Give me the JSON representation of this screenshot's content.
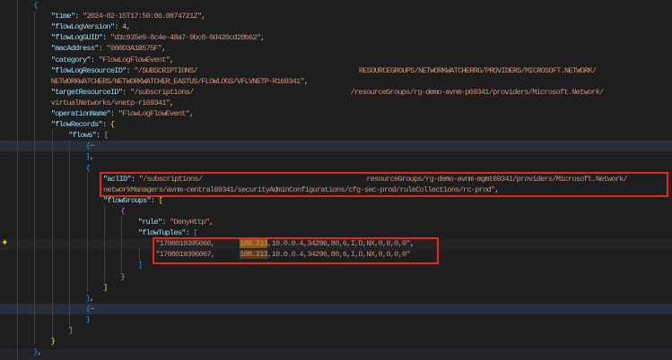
{
  "colors": {
    "key": "#9cdcfe",
    "string": "#ce9178",
    "number": "#b5cea8",
    "bracket_gold": "#ffd700",
    "bracket_purple": "#da70d6",
    "bracket_blue": "#179fff",
    "highlight_box": "#e0291c"
  },
  "icons": {
    "gutter": "sparkle-icon",
    "fold": "fold-ellipsis-icon"
  },
  "lines": [
    {
      "lv": 1,
      "t": [
        [
          "b3",
          "{"
        ]
      ]
    },
    {
      "lv": 2,
      "t": [
        [
          "k",
          "\"time\""
        ],
        [
          "p",
          ": "
        ],
        [
          "s",
          "\"2024-02-15T17:50:06.0874721Z\""
        ],
        [
          "p",
          ","
        ]
      ]
    },
    {
      "lv": 2,
      "t": [
        [
          "k",
          "\"flowLogVersion\""
        ],
        [
          "p",
          ": "
        ],
        [
          "n",
          "4"
        ],
        [
          "p",
          ","
        ]
      ]
    },
    {
      "lv": 2,
      "t": [
        [
          "k",
          "\"flowLogGUID\""
        ],
        [
          "p",
          ": "
        ],
        [
          "s",
          "\"d3c935e9-8c4e-48a7-9bc0-0d420cd20b62\""
        ],
        [
          "p",
          ","
        ]
      ]
    },
    {
      "lv": 2,
      "t": [
        [
          "k",
          "\"macAddress\""
        ],
        [
          "p",
          ": "
        ],
        [
          "s",
          "\"000D3A1B575F\""
        ],
        [
          "p",
          ","
        ]
      ]
    },
    {
      "lv": 2,
      "t": [
        [
          "k",
          "\"category\""
        ],
        [
          "p",
          ": "
        ],
        [
          "s",
          "\"FlowLogFlowEvent\""
        ],
        [
          "p",
          ","
        ]
      ]
    },
    {
      "lv": 2,
      "t": [
        [
          "k",
          "\"flowLogResourceID\""
        ],
        [
          "p",
          ": "
        ],
        [
          "s",
          "\"/SUBSCRIPTIONS/"
        ],
        [
          "gap",
          ""
        ],
        [
          "s",
          "RESOURCEGROUPS/NETWORKWATCHERRG/PROVIDERS/MICROSOFT.NETWORK/"
        ]
      ]
    },
    {
      "lv": 2,
      "t": [
        [
          "s",
          "NETWORKWATCHERS/NETWORKWATCHER_EASTUS/FLOWLOGS/VFLVNETP-R169341\""
        ],
        [
          "p",
          ","
        ]
      ]
    },
    {
      "lv": 2,
      "t": [
        [
          "k",
          "\"targetResourceID\""
        ],
        [
          "p",
          ": "
        ],
        [
          "s",
          "\"/subscriptions/"
        ],
        [
          "gap",
          ""
        ],
        [
          "s",
          "/resourceGroups/rg-demo-avnm-p69341/providers/Microsoft.Network/"
        ]
      ]
    },
    {
      "lv": 2,
      "t": [
        [
          "s",
          "virtualNetworks/vnetp-r169341\""
        ],
        [
          "p",
          ","
        ]
      ]
    },
    {
      "lv": 2,
      "t": [
        [
          "k",
          "\"operationName\""
        ],
        [
          "p",
          ": "
        ],
        [
          "s",
          "\"FlowLogFlowEvent\""
        ],
        [
          "p",
          ","
        ]
      ]
    },
    {
      "lv": 2,
      "t": [
        [
          "k",
          "\"flowRecords\""
        ],
        [
          "p",
          ": "
        ],
        [
          "b1",
          "{"
        ]
      ]
    },
    {
      "lv": 3,
      "t": [
        [
          "k",
          "\"flows\""
        ],
        [
          "p",
          ": "
        ],
        [
          "b2",
          "["
        ]
      ]
    },
    {
      "lv": 4,
      "t": [
        [
          "b3",
          "{"
        ],
        [
          "f",
          "⋯"
        ]
      ]
    },
    {
      "lv": 4,
      "t": [
        [
          "b3",
          "}"
        ],
        [
          "p",
          ","
        ]
      ]
    },
    {
      "lv": 4,
      "t": [
        [
          "b3",
          "{"
        ]
      ]
    },
    {
      "lv": 5,
      "t": [
        [
          "k",
          "\"aclID\""
        ],
        [
          "p",
          ": "
        ],
        [
          "s",
          "\"/subscriptions/"
        ],
        [
          "gap",
          ""
        ],
        [
          "s",
          "resourceGroups/rg-demo-avnm-mgmt69341/providers/Microsoft.Network/"
        ]
      ]
    },
    {
      "lv": 5,
      "t": [
        [
          "s",
          "networkManagers/avnm-central69341/securityAdminConfigurations/cfg-sec-prod/ruleCollections/rc-prod\""
        ],
        [
          "p",
          ","
        ]
      ]
    },
    {
      "lv": 5,
      "t": [
        [
          "k",
          "\"flowGroups\""
        ],
        [
          "p",
          ": "
        ],
        [
          "b1",
          "["
        ]
      ]
    },
    {
      "lv": 6,
      "t": [
        [
          "b2",
          "{"
        ]
      ]
    },
    {
      "lv": 7,
      "t": [
        [
          "k",
          "\"rule\""
        ],
        [
          "p",
          ": "
        ],
        [
          "s",
          "\"DenyHttp\""
        ],
        [
          "p",
          ","
        ]
      ]
    },
    {
      "lv": 7,
      "t": [
        [
          "k",
          "\"flowTuples\""
        ],
        [
          "p",
          ": "
        ],
        [
          "b3",
          "["
        ]
      ]
    },
    {
      "lv": 8,
      "t": [
        [
          "s",
          "\"1708019395066,"
        ],
        [
          "gap",
          ""
        ],
        [
          "ip",
          "108.213"
        ],
        [
          "s",
          ",10.0.0.4,34296,80,6,I,D,NX,0,0,0,0\""
        ],
        [
          "p",
          ","
        ]
      ]
    },
    {
      "lv": 8,
      "t": [
        [
          "s",
          "\"1708019396067,"
        ],
        [
          "gap",
          ""
        ],
        [
          "ip2",
          "108.213"
        ],
        [
          "s",
          ",10.0.0.4,34296,80,6,I,D,NX,0,0,0,0\""
        ]
      ]
    },
    {
      "lv": 7,
      "t": [
        [
          "b3",
          "]"
        ]
      ]
    },
    {
      "lv": 6,
      "t": [
        [
          "b2",
          "}"
        ]
      ]
    },
    {
      "lv": 5,
      "t": [
        [
          "b1",
          "]"
        ]
      ]
    },
    {
      "lv": 4,
      "t": [
        [
          "b3",
          "}"
        ],
        [
          "p",
          ","
        ]
      ]
    },
    {
      "lv": 4,
      "t": [
        [
          "b3",
          "{"
        ],
        [
          "f",
          "⋯"
        ]
      ]
    },
    {
      "lv": 4,
      "t": [
        [
          "b3",
          "}"
        ]
      ]
    },
    {
      "lv": 3,
      "t": [
        [
          "b2",
          "]"
        ]
      ]
    },
    {
      "lv": 2,
      "t": [
        [
          "b1",
          "}"
        ]
      ]
    },
    {
      "lv": 1,
      "t": [
        [
          "b3",
          "}"
        ],
        [
          "p",
          ","
        ]
      ]
    }
  ]
}
